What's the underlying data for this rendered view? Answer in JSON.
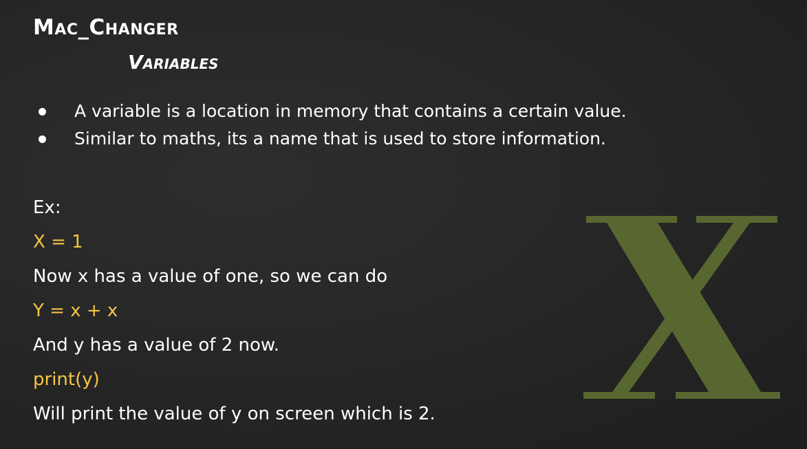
{
  "slide": {
    "title": "Mac_Changer",
    "subtitle": "Variables",
    "bullets": [
      "A variable is a location in memory that contains a certain value.",
      "Similar to maths, its a name that is used to store information."
    ],
    "example_lines": [
      {
        "text": "Ex:",
        "style": "white"
      },
      {
        "text": "X = 1",
        "style": "code"
      },
      {
        "text": "Now x has a value of one, so we can do",
        "style": "white"
      },
      {
        "text": "Y = x + x",
        "style": "code"
      },
      {
        "text": "And y has a value of 2 now.",
        "style": "white"
      },
      {
        "text": "print(y)",
        "style": "code"
      },
      {
        "text": "Will print the value of y on screen which is 2.",
        "style": "white"
      }
    ],
    "big_letter": "X"
  },
  "colors": {
    "background": "#262626",
    "text": "#ffffff",
    "code_accent": "#f6c544",
    "big_letter": "#58672f"
  }
}
